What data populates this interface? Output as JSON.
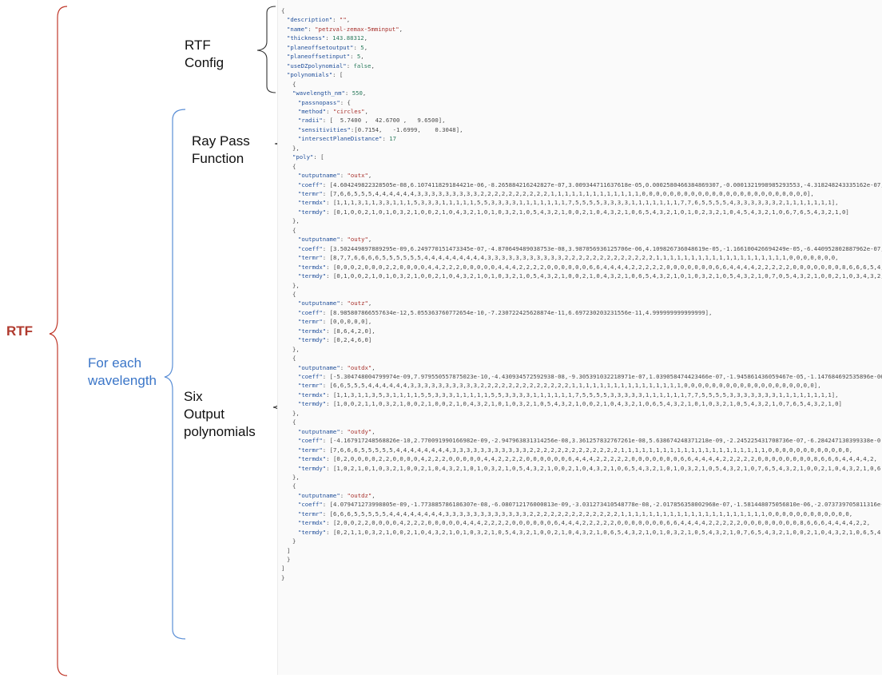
{
  "labels": {
    "rtf": "RTF",
    "rtf_config": [
      "RTF",
      "Config"
    ],
    "for_each_wavelength": [
      "For each",
      "wavelength"
    ],
    "ray_pass": [
      "Ray Pass",
      "Function"
    ],
    "six_output": [
      "Six",
      "Output",
      "polynomials"
    ]
  },
  "colors": {
    "rtf_brace": "#c0392b",
    "rtf_text": "#b03a2e",
    "wavelength_brace": "#5b8fd6",
    "wavelength_text": "#3b76c8",
    "inner_brace": "#333333",
    "code_key": "#1f4e9a",
    "code_string": "#a8322d",
    "code_number": "#2a7a5c"
  },
  "code_lines": [
    {
      "indent": 0,
      "text": "{"
    },
    {
      "indent": 1,
      "text": "\"description\": \"\","
    },
    {
      "indent": 1,
      "text": "\"name\": \"petzval-zemax-5mminput\","
    },
    {
      "indent": 1,
      "text": "\"thickness\": 143.88312,"
    },
    {
      "indent": 1,
      "text": "\"planeoffsetoutput\": 5,"
    },
    {
      "indent": 1,
      "text": "\"planeoffsetinput\": 5,"
    },
    {
      "indent": 1,
      "text": "\"useDZpolynomial\": false,"
    },
    {
      "indent": 1,
      "text": "\"polynomials\": ["
    },
    {
      "indent": 2,
      "text": "{"
    },
    {
      "indent": 2,
      "text": "\"wavelength_nm\": 550,"
    },
    {
      "indent": 3,
      "text": "\"passnopass\": {"
    },
    {
      "indent": 3,
      "text": "\"method\": \"circles\","
    },
    {
      "indent": 3,
      "text": "\"radii\": [  5.7400 ,  42.6700 ,   9.6500],"
    },
    {
      "indent": 3,
      "text": "\"sensitivities\":[0.7154,   -1.6999,    0.3048],"
    },
    {
      "indent": 3,
      "text": "\"intersectPlaneDistance\": 17"
    },
    {
      "indent": 2,
      "text": "},"
    },
    {
      "indent": 2,
      "text": "\"poly\": ["
    },
    {
      "indent": 2,
      "text": "{"
    },
    {
      "indent": 3,
      "text": "\"outputname\": \"outx\","
    },
    {
      "indent": 3,
      "text": "\"coeff\": [4.604249822328505e-08,6.107411829184421e-06,-8.265884216242827e-07,3.009344711637618e-05,0.0002580466384869307,-0.0001321998985293553,-4.318248243335162e-07,"
    },
    {
      "indent": 3,
      "text": "\"termr\": [7,6,6,5,5,5,4,4,4,4,4,4,3,3,3,3,3,3,3,3,3,2,2,2,2,2,2,2,2,2,2,1,1,1,1,1,1,1,1,1,1,1,1,1,0,0,0,0,0,0,0,0,0,0,0,0,0,0,0,0,0,0,0,0,0,0,0,0],"
    },
    {
      "indent": 3,
      "text": "\"termdx\": [1,1,1,3,1,1,3,3,1,1,1,5,3,3,3,1,1,1,1,1,5,5,3,3,3,3,1,1,1,1,1,1,1,7,5,5,5,5,3,3,3,3,1,1,1,1,1,1,1,7,7,6,5,5,5,5,4,3,3,3,3,3,3,2,1,1,1,1,1,1,1],"
    },
    {
      "indent": 3,
      "text": "\"termdy\": [0,1,0,0,2,1,0,1,0,3,2,1,0,0,2,1,0,4,3,2,1,0,1,0,3,2,1,0,5,4,3,2,1,0,0,2,1,0,4,3,2,1,0,6,5,4,3,2,1,0,1,0,2,3,2,1,0,4,5,4,3,2,1,0,6,7,6,5,4,3,2,1,0]"
    },
    {
      "indent": 2,
      "text": "},"
    },
    {
      "indent": 2,
      "text": "{"
    },
    {
      "indent": 3,
      "text": "\"outputname\": \"outy\","
    },
    {
      "indent": 3,
      "text": "\"coeff\": [3.502449897889295e-09,6.249770151473345e-07,-4.870649489038753e-08,3.987056936125706e-06,4.109826736048619e-05,-1.166100426694249e-05,-6.440952802887962e-07,"
    },
    {
      "indent": 3,
      "text": "\"termr\": [8,7,7,6,6,6,6,5,5,5,5,5,5,4,4,4,4,4,4,4,4,4,3,3,3,3,3,3,3,3,3,3,3,2,2,2,2,2,2,2,2,2,2,2,2,2,1,1,1,1,1,1,1,1,1,1,1,1,1,1,1,1,1,1,1,0,0,0,0,0,0,0,"
    },
    {
      "indent": 3,
      "text": "\"termdx\": [0,0,0,2,0,0,0,2,2,0,0,0,0,4,4,2,2,2,0,0,0,0,0,4,4,4,2,2,2,2,0,0,0,0,0,0,6,6,4,4,4,4,2,2,2,2,2,0,0,0,0,0,0,0,6,6,4,4,4,4,2,2,2,2,2,0,0,0,0,0,0,0,8,6,6,6,5,4,4,"
    },
    {
      "indent": 3,
      "text": "\"termdy\": [0,1,0,0,2,1,0,1,0,3,2,1,0,0,2,1,0,4,3,2,1,0,1,0,3,2,1,0,5,4,3,2,1,0,0,2,1,0,4,3,2,1,0,6,5,4,3,2,1,0,1,0,3,2,1,0,5,4,3,2,1,0,7,0,5,4,3,2,1,0,0,2,1,0,3,4,3,2,"
    },
    {
      "indent": 2,
      "text": "},"
    },
    {
      "indent": 2,
      "text": "{"
    },
    {
      "indent": 3,
      "text": "\"outputname\": \"outz\","
    },
    {
      "indent": 3,
      "text": "\"coeff\": [8.985807866557634e-12,5.055363760772654e-10,-7.230722425628874e-11,6.697230203231556e-11,4.999999999999999],"
    },
    {
      "indent": 3,
      "text": "\"termr\": [0,0,0,0,0],"
    },
    {
      "indent": 3,
      "text": "\"termdx\": [8,6,4,2,0],"
    },
    {
      "indent": 3,
      "text": "\"termdy\": [0,2,4,6,0]"
    },
    {
      "indent": 2,
      "text": "},"
    },
    {
      "indent": 2,
      "text": "{"
    },
    {
      "indent": 3,
      "text": "\"outputname\": \"outdx\","
    },
    {
      "indent": 3,
      "text": "\"coeff\": [-5.304748004799974e-09,7.979550557875023e-10,-4.430934572592938-08,-9.305391032218971e-07,1.039058474423466e-07,-1.945861436059467e-05,-1.147684692535896e-06"
    },
    {
      "indent": 3,
      "text": "\"termr\": [6,6,5,5,5,4,4,4,4,4,4,3,3,3,3,3,3,3,3,3,3,2,2,2,2,2,2,2,2,2,2,2,2,2,1,1,1,1,1,1,1,1,1,1,1,1,1,1,1,1,0,0,0,0,0,0,0,0,0,0,0,0,0,0,0,0,0,0,0],"
    },
    {
      "indent": 3,
      "text": "\"termdx\": [1,1,3,1,1,3,5,3,1,1,1,1,5,5,3,3,3,1,1,1,1,1,5,5,3,3,3,3,1,1,1,1,1,1,7,5,5,5,5,3,3,3,3,3,1,1,1,1,1,1,7,7,5,5,5,5,3,3,3,3,3,3,3,1,1,1,1,1,1,1,1],"
    },
    {
      "indent": 3,
      "text": "\"termdy\": [1,0,0,2,1,1,0,3,2,1,0,0,2,1,0,0,2,1,0,4,3,2,1,0,1,0,3,2,1,0,5,4,3,2,1,0,0,2,1,0,4,3,2,1,0,6,5,4,3,2,1,0,1,0,3,2,1,0,5,4,3,2,1,0,7,6,5,4,3,2,1,0]"
    },
    {
      "indent": 2,
      "text": "},"
    },
    {
      "indent": 2,
      "text": "{"
    },
    {
      "indent": 3,
      "text": "\"outputname\": \"outdy\","
    },
    {
      "indent": 3,
      "text": "\"coeff\": [-4.167917248568826e-10,2.770091990166982e-09,-2.947963831314256e-08,3.361257832767261e-08,5.638674248371218e-09,-2.245225431708736e-07,-6.284247130399338e-0"
    },
    {
      "indent": 3,
      "text": "\"termr\": [7,6,6,6,5,5,5,5,5,4,4,4,4,4,4,4,4,3,3,3,3,3,3,3,3,3,3,3,2,2,2,2,2,2,2,2,2,2,2,2,2,1,1,1,1,1,1,1,1,1,1,1,1,1,1,1,1,1,1,1,1,1,0,0,0,0,0,0,0,0,0,0,0,0,"
    },
    {
      "indent": 3,
      "text": "\"termdx\": [0,2,0,0,0,0,2,2,0,0,0,0,4,2,2,2,0,0,0,0,0,4,4,2,2,2,2,0,0,0,0,0,0,6,4,4,4,2,2,2,2,2,0,0,0,0,0,0,0,6,6,4,4,4,4,2,2,2,2,2,0,0,0,0,0,0,0,0,8,6,6,6,4,4,4,4,2,"
    },
    {
      "indent": 3,
      "text": "\"termdy\": [1,0,2,1,0,1,0,3,2,1,0,0,2,1,0,4,3,2,1,0,1,0,3,2,1,0,5,4,3,2,1,0,0,2,1,0,4,3,2,1,0,6,5,4,3,2,1,0,1,0,3,2,1,0,5,4,3,2,1,0,7,6,5,4,3,2,1,0,0,2,1,0,4,3,2,1,0,6"
    },
    {
      "indent": 2,
      "text": "},"
    },
    {
      "indent": 2,
      "text": "{"
    },
    {
      "indent": 3,
      "text": "\"outputname\": \"outdz\","
    },
    {
      "indent": 3,
      "text": "\"coeff\": [4.079471273998805e-09,-1.773885786186307e-08,-6.080712176000813e-09,-3.031273410548778e-08,-2.017856358002968e-07,-1.581448075056810e-06,-2.073739705811316e-0"
    },
    {
      "indent": 3,
      "text": "\"termr\": [6,6,6,5,5,5,5,5,4,4,4,4,4,4,4,4,3,3,3,3,3,3,3,3,3,3,3,3,2,2,2,2,2,2,2,2,2,2,2,2,2,1,1,1,1,1,1,1,1,1,1,1,1,1,1,1,1,1,1,1,1,1,0,0,0,0,0,0,0,0,0,0,0,0,"
    },
    {
      "indent": 3,
      "text": "\"termdx\": [2,0,0,2,2,0,0,0,0,4,2,2,2,0,0,0,0,0,4,4,4,2,2,2,2,0,0,0,0,0,0,6,4,4,4,2,2,2,2,2,0,0,0,0,0,0,0,6,6,4,4,4,4,2,2,2,2,2,0,0,0,0,0,0,0,0,8,6,6,6,4,4,4,4,2,2,"
    },
    {
      "indent": 3,
      "text": "\"termdy\": [0,2,1,1,0,3,2,1,0,0,2,1,0,4,3,2,1,0,1,0,3,2,1,0,5,4,3,2,1,0,0,2,1,0,4,3,2,1,0,6,5,4,3,2,1,0,1,0,3,2,1,0,5,4,3,2,1,0,7,6,5,4,3,2,1,0,0,2,1,0,4,3,2,1,0,6,5,4"
    },
    {
      "indent": 2,
      "text": "}"
    },
    {
      "indent": 1,
      "text": "]"
    },
    {
      "indent": 1,
      "text": "}"
    },
    {
      "indent": 0,
      "text": "]"
    },
    {
      "indent": 0,
      "text": "}"
    }
  ]
}
